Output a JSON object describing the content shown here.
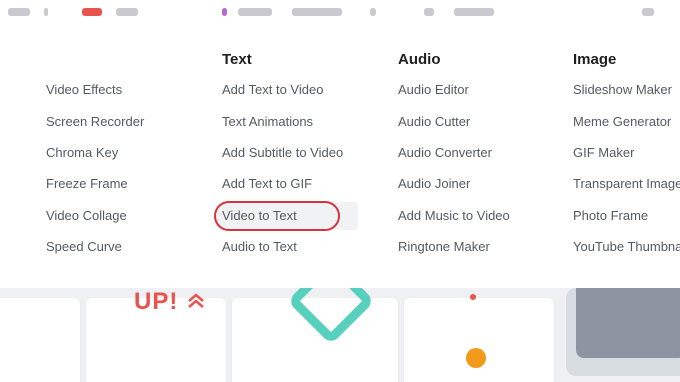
{
  "menu": {
    "columns": [
      {
        "key": "video",
        "title": "",
        "items": [
          "Video Effects",
          "Screen Recorder",
          "Chroma Key",
          "Freeze Frame",
          "Video Collage",
          "Speed Curve"
        ]
      },
      {
        "key": "text",
        "title": "Text",
        "items": [
          "Add Text to Video",
          "Text Animations",
          "Add Subtitle to Video",
          "Add Text to GIF",
          "Video to Text",
          "Audio to Text"
        ],
        "highlighted_index": 4
      },
      {
        "key": "audio",
        "title": "Audio",
        "items": [
          "Audio Editor",
          "Audio Cutter",
          "Audio Converter",
          "Audio Joiner",
          "Add Music to Video",
          "Ringtone Maker"
        ]
      },
      {
        "key": "image",
        "title": "Image",
        "items": [
          "Slideshow Maker",
          "Meme Generator",
          "GIF Maker",
          "Transparent Image",
          "Photo Frame",
          "YouTube Thumbnail"
        ]
      }
    ]
  },
  "hero": {
    "badge_text": "UP!"
  },
  "colors": {
    "highlight_ring": "#d3353d",
    "accent_teal": "#57d0bd",
    "accent_orange": "#f39a1a",
    "accent_red": "#e8534d"
  }
}
